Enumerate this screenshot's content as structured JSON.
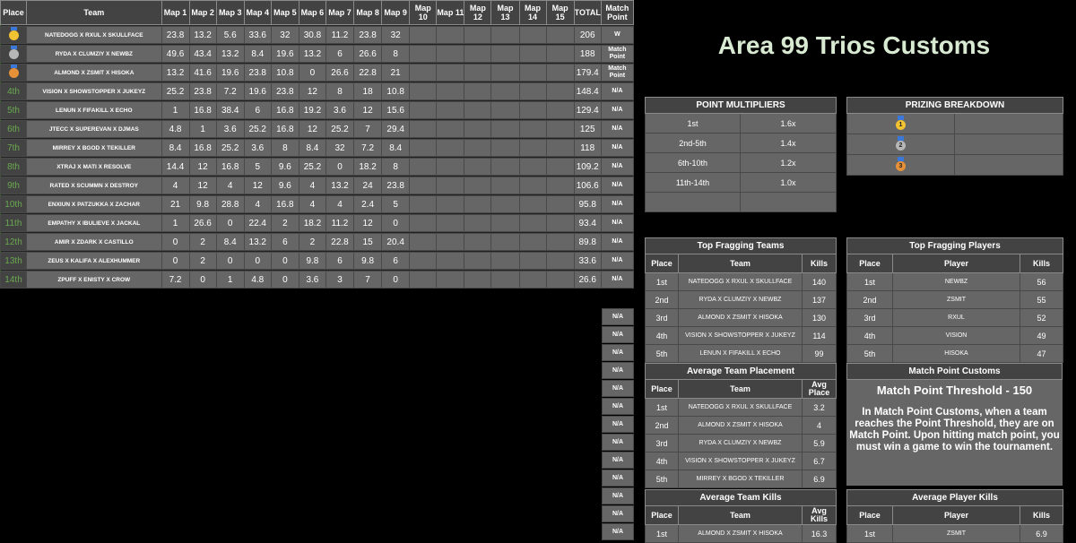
{
  "standings": {
    "headers": {
      "place": "Place",
      "team": "Team",
      "maps": [
        "Map 1",
        "Map 2",
        "Map 3",
        "Map 4",
        "Map 5",
        "Map 6",
        "Map 7",
        "Map 8",
        "Map 9",
        "Map 10",
        "Map 11",
        "Map 12",
        "Map 13",
        "Map 14",
        "Map 15"
      ],
      "total": "TOTAL",
      "match_point": "Match Point"
    },
    "rows": [
      {
        "place": "1st",
        "medal": "gold",
        "team": "NATEDOGG X RXUL X SKULLFACE",
        "maps": [
          "23.8",
          "13.2",
          "5.6",
          "33.6",
          "32",
          "30.8",
          "11.2",
          "23.8",
          "32"
        ],
        "total": "206",
        "mp": "W"
      },
      {
        "place": "2nd",
        "medal": "silver",
        "team": "RYDA X CLUMZIY X NEWBZ",
        "maps": [
          "49.6",
          "43.4",
          "13.2",
          "8.4",
          "19.6",
          "13.2",
          "6",
          "26.6",
          "8"
        ],
        "total": "188",
        "mp": "Match Point"
      },
      {
        "place": "3rd",
        "medal": "bronze",
        "team": "ALMOND X ZSMIT X HISOKA",
        "maps": [
          "13.2",
          "41.6",
          "19.6",
          "23.8",
          "10.8",
          "0",
          "26.6",
          "22.8",
          "21"
        ],
        "total": "179.4",
        "mp": "Match Point"
      },
      {
        "place": "4th",
        "team": "VISION X SHOWSTOPPER X JUKEYZ",
        "maps": [
          "25.2",
          "23.8",
          "7.2",
          "19.6",
          "23.8",
          "12",
          "8",
          "18",
          "10.8"
        ],
        "total": "148.4",
        "mp": "N/A"
      },
      {
        "place": "5th",
        "team": "LENUN X FIFAKILL X ECHO",
        "maps": [
          "1",
          "16.8",
          "38.4",
          "6",
          "16.8",
          "19.2",
          "3.6",
          "12",
          "15.6"
        ],
        "total": "129.4",
        "mp": "N/A"
      },
      {
        "place": "6th",
        "team": "JTECC X SUPEREVAN X DJMAS",
        "maps": [
          "4.8",
          "1",
          "3.6",
          "25.2",
          "16.8",
          "12",
          "25.2",
          "7",
          "29.4"
        ],
        "total": "125",
        "mp": "N/A"
      },
      {
        "place": "7th",
        "team": "MIRREY X BGOD X TEKILLER",
        "maps": [
          "8.4",
          "16.8",
          "25.2",
          "3.6",
          "8",
          "8.4",
          "32",
          "7.2",
          "8.4"
        ],
        "total": "118",
        "mp": "N/A"
      },
      {
        "place": "8th",
        "team": "XTRAJ X MATI X RESOLVE",
        "maps": [
          "14.4",
          "12",
          "16.8",
          "5",
          "9.6",
          "25.2",
          "0",
          "18.2",
          "8"
        ],
        "total": "109.2",
        "mp": "N/A"
      },
      {
        "place": "9th",
        "team": "RATED X SCUMMN X DESTROY",
        "maps": [
          "4",
          "12",
          "4",
          "12",
          "9.6",
          "4",
          "13.2",
          "24",
          "23.8"
        ],
        "total": "106.6",
        "mp": "N/A"
      },
      {
        "place": "10th",
        "team": "ENXIUN X PATZUKKA X ZACHAR",
        "maps": [
          "21",
          "9.8",
          "28.8",
          "4",
          "16.8",
          "4",
          "4",
          "2.4",
          "5"
        ],
        "total": "95.8",
        "mp": "N/A"
      },
      {
        "place": "11th",
        "team": "EMPATHY X IBULIEVE X JACKAL",
        "maps": [
          "1",
          "26.6",
          "0",
          "22.4",
          "2",
          "18.2",
          "11.2",
          "12",
          "0"
        ],
        "total": "93.4",
        "mp": "N/A"
      },
      {
        "place": "12th",
        "team": "AMIR X ZDARK X CASTILLO",
        "maps": [
          "0",
          "2",
          "8.4",
          "13.2",
          "6",
          "2",
          "22.8",
          "15",
          "20.4"
        ],
        "total": "89.8",
        "mp": "N/A"
      },
      {
        "place": "13th",
        "team": "ZEUS X KALIFA X ALEXHUMMER",
        "maps": [
          "0",
          "2",
          "0",
          "0",
          "0",
          "9.8",
          "6",
          "9.8",
          "6"
        ],
        "total": "33.6",
        "mp": "N/A"
      },
      {
        "place": "14th",
        "team": "ZPUFF X ENISTY X CROW",
        "maps": [
          "7.2",
          "0",
          "1",
          "4.8",
          "0",
          "3.6",
          "3",
          "7",
          "0"
        ],
        "total": "26.6",
        "mp": "N/A"
      }
    ],
    "extra_na": [
      "N/A",
      "N/A",
      "N/A",
      "N/A",
      "N/A",
      "N/A",
      "N/A",
      "N/A",
      "N/A",
      "N/A",
      "N/A",
      "N/A",
      "N/A"
    ]
  },
  "title": "Area 99 Trios Customs",
  "multipliers": {
    "header": "POINT MULTIPLIERS",
    "rows": [
      [
        "1st",
        "1.6x"
      ],
      [
        "2nd-5th",
        "1.4x"
      ],
      [
        "6th-10th",
        "1.2x"
      ],
      [
        "11th-14th",
        "1.0x"
      ],
      [
        "",
        ""
      ]
    ]
  },
  "prizing": {
    "header": "PRIZING BREAKDOWN"
  },
  "top_teams": {
    "header": "Top Fragging Teams",
    "cols": [
      "Place",
      "Team",
      "Kills"
    ],
    "rows": [
      [
        "1st",
        "NATEDOGG X RXUL X SKULLFACE",
        "140"
      ],
      [
        "2nd",
        "RYDA X CLUMZIY X NEWBZ",
        "137"
      ],
      [
        "3rd",
        "ALMOND X ZSMIT X HISOKA",
        "130"
      ],
      [
        "4th",
        "VISION X SHOWSTOPPER X JUKEYZ",
        "114"
      ],
      [
        "5th",
        "LENUN X FIFAKILL X ECHO",
        "99"
      ]
    ]
  },
  "top_players": {
    "header": "Top Fragging Players",
    "cols": [
      "Place",
      "Player",
      "Kills"
    ],
    "rows": [
      [
        "1st",
        "NEWBZ",
        "56"
      ],
      [
        "2nd",
        "ZSMIT",
        "55"
      ],
      [
        "3rd",
        "RXUL",
        "52"
      ],
      [
        "4th",
        "VISION",
        "49"
      ],
      [
        "5th",
        "HISOKA",
        "47"
      ]
    ]
  },
  "avg_placement": {
    "header": "Average Team Placement",
    "cols": [
      "Place",
      "Team",
      "Avg Place"
    ],
    "rows": [
      [
        "1st",
        "NATEDOGG X RXUL X SKULLFACE",
        "3.2"
      ],
      [
        "2nd",
        "ALMOND X ZSMIT X HISOKA",
        "4"
      ],
      [
        "3rd",
        "RYDA X CLUMZIY X NEWBZ",
        "5.9"
      ],
      [
        "4th",
        "VISION X SHOWSTOPPER X JUKEYZ",
        "6.7"
      ],
      [
        "5th",
        "MIRREY X BGOD X TEKILLER",
        "6.9"
      ]
    ]
  },
  "match_point": {
    "header": "Match Point Customs",
    "threshold": "Match Point Threshold - 150",
    "text": "In Match Point Customs, when a team reaches the Point Threshold, they are on Match Point. Upon hitting match point, you must win a game to win the tournament."
  },
  "avg_kills": {
    "header": "Average Team Kills",
    "cols": [
      "Place",
      "Team",
      "Avg Kills"
    ],
    "rows": [
      [
        "1st",
        "ALMOND X ZSMIT X HISOKA",
        "16.3"
      ]
    ]
  },
  "avg_player_kills": {
    "header": "Average Player Kills",
    "cols": [
      "Place",
      "Player",
      "Kills"
    ],
    "rows": [
      [
        "1st",
        "ZSMIT",
        "6.9"
      ]
    ]
  }
}
